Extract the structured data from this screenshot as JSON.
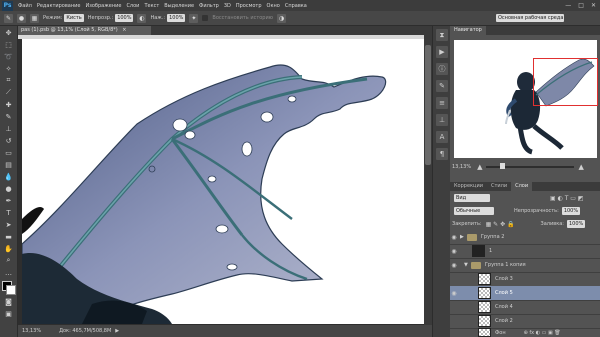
{
  "app": {
    "logo": "Ps"
  },
  "menu": [
    "Файл",
    "Редактирование",
    "Изображение",
    "Слои",
    "Текст",
    "Выделение",
    "Фильтр",
    "3D",
    "Просмотр",
    "Окно",
    "Справка"
  ],
  "window_controls": [
    "—",
    "□",
    "✕"
  ],
  "options": {
    "mode_label": "Режим:",
    "mode_value": "Кисть",
    "opacity_label": "Непрозр.:",
    "opacity_value": "100%",
    "flow_label": "Наж.:",
    "flow_value": "100%",
    "history_label": "Восстановить историю",
    "workspace": "Основная рабочая среда"
  },
  "document": {
    "tab_title": "pas (1).psb @ 13,1% (Слой 5, RGB/8*)",
    "close_icon": "×"
  },
  "status": {
    "zoom": "13,13%",
    "doc_size": "Док: 465,7M/508,8M"
  },
  "navigator": {
    "tab": "Навигатор",
    "zoom": "13,13%"
  },
  "layers_panel": {
    "tabs": [
      "Коррекции",
      "Стили",
      "Слои"
    ],
    "filter_label": "Вид",
    "blend_mode": "Обычные",
    "opacity_label": "Непрозрачность:",
    "opacity_value": "100%",
    "lock_label": "Закрепить:",
    "fill_label": "Заливка:",
    "fill_value": "100%",
    "layers": [
      {
        "name": "Группа 2",
        "kind": "group"
      },
      {
        "name": "1",
        "kind": "layer"
      },
      {
        "name": "Группа 1 копия",
        "kind": "group"
      },
      {
        "name": "Слой 3",
        "kind": "layer"
      },
      {
        "name": "Слой 5",
        "kind": "layer",
        "selected": true
      },
      {
        "name": "Слой 4",
        "kind": "layer"
      },
      {
        "name": "Слой 2",
        "kind": "layer"
      },
      {
        "name": "Фон",
        "kind": "layer"
      }
    ]
  },
  "colors": {
    "accent": "#7d8dac",
    "nav_frame": "#e03030"
  }
}
